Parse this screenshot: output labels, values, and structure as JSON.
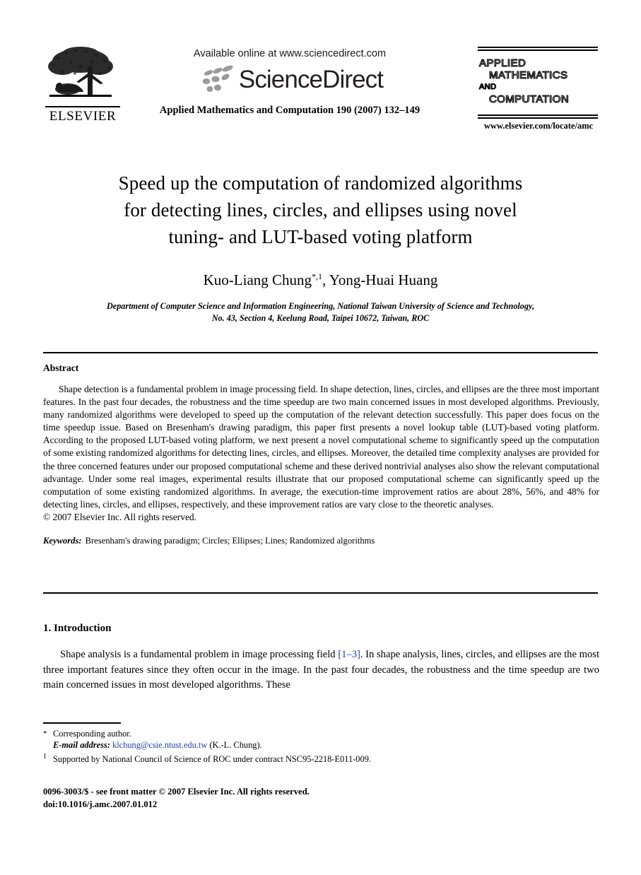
{
  "masthead": {
    "publisher_name": "ELSEVIER",
    "available_online": "Available online at www.sciencedirect.com",
    "sciencedirect_wordmark": "ScienceDirect",
    "journal_reference": "Applied Mathematics and Computation 190 (2007) 132–149",
    "cover": {
      "line1": "APPLIED",
      "line2": "MATHEMATICS",
      "line3": "AND",
      "line4": "COMPUTATION"
    },
    "journal_url": "www.elsevier.com/locate/amc"
  },
  "title": {
    "line1": "Speed up the computation of randomized algorithms",
    "line2": "for detecting lines, circles, and ellipses using novel",
    "line3": "tuning- and LUT-based voting platform"
  },
  "authors": {
    "text_before": "Kuo-Liang Chung",
    "marker": "*,1",
    "text_after": ", Yong-Huai Huang"
  },
  "affiliation": {
    "line1": "Department of Computer Science and Information Engineering, National Taiwan University of Science and Technology,",
    "line2": "No. 43, Section 4, Keelung Road, Taipei 10672, Taiwan, ROC"
  },
  "abstract": {
    "heading": "Abstract",
    "body": "Shape detection is a fundamental problem in image processing field. In shape detection, lines, circles, and ellipses are the three most important features. In the past four decades, the robustness and the time speedup are two main concerned issues in most developed algorithms. Previously, many randomized algorithms were developed to speed up the computation of the relevant detection successfully. This paper does focus on the time speedup issue. Based on Bresenham's drawing paradigm, this paper first presents a novel lookup table (LUT)-based voting platform. According to the proposed LUT-based voting platform, we next present a novel computational scheme to significantly speed up the computation of some existing randomized algorithms for detecting lines, circles, and ellipses. Moreover, the detailed time complexity analyses are provided for the three concerned features under our proposed computational scheme and these derived nontrivial analyses also show the relevant computational advantage. Under some real images, experimental results illustrate that our proposed computational scheme can significantly speed up the computation of some existing randomized algorithms. In average, the execution-time improvement ratios are about 28%, 56%, and 48% for detecting lines, circles, and ellipses, respectively, and these improvement ratios are vary close to the theoretic analyses.",
    "copyright": "© 2007 Elsevier Inc. All rights reserved."
  },
  "keywords": {
    "label": "Keywords:",
    "list": "Bresenham's drawing paradigm; Circles; Ellipses; Lines; Randomized algorithms"
  },
  "introduction": {
    "heading": "1. Introduction",
    "para_part1": "Shape analysis is a fundamental problem in image processing field ",
    "citation": "[1–3]",
    "para_part2": ". In shape analysis, lines, circles, and ellipses are the most three important features since they often occur in the image. In the past four decades, the robustness and the time speedup are two main concerned issues in most developed algorithms. These"
  },
  "footnotes": {
    "corresponding_marker": "*",
    "corresponding_text": "Corresponding author.",
    "email_label": "E-mail address:",
    "email_address": "klchung@csie.ntust.edu.tw",
    "email_suffix": "(K.-L. Chung).",
    "support_marker": "1",
    "support_text": "Supported by National Council of Science of ROC under contract NSC95-2218-E011-009."
  },
  "imprint": {
    "line1": "0096-3003/$ - see front matter © 2007 Elsevier Inc. All rights reserved.",
    "line2": "doi:10.1016/j.amc.2007.01.012"
  },
  "colors": {
    "link": "#1e3fa8",
    "text": "#000000",
    "background": "#ffffff",
    "sciencedirect_gray": "#9a9a9a"
  }
}
